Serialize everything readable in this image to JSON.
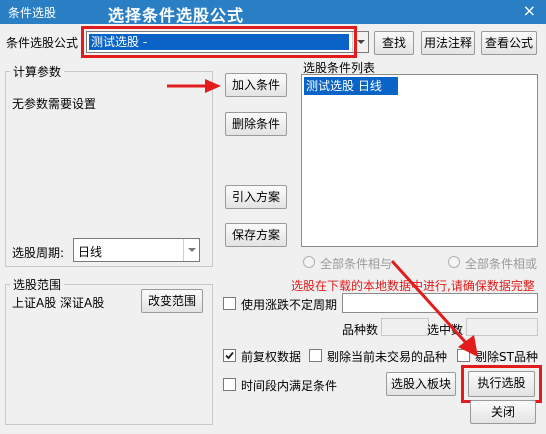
{
  "window": {
    "title": "条件选股",
    "close_glyph": "×"
  },
  "annotation": {
    "title": "选择条件选股公式",
    "color": "#e21c1c"
  },
  "formula": {
    "label": "条件选股公式",
    "selected_value": "测试选股     -",
    "btn_find": "查找",
    "btn_usage": "用法注释",
    "btn_view": "查看公式"
  },
  "params": {
    "group_title": "计算参数",
    "no_params_text": "无参数需要设置",
    "period_label": "选股周期:",
    "period_value": "日线"
  },
  "actions": {
    "add_condition": "加入条件",
    "delete_condition": "删除条件",
    "import_plan": "引入方案",
    "save_plan": "保存方案"
  },
  "condition_list": {
    "label": "选股条件列表",
    "items": [
      "测试选股  日线"
    ]
  },
  "logic": {
    "all_and": "全部条件相与",
    "all_or": "全部条件相或"
  },
  "notice": "选股在下载的本地数据中进行,请确保数据完整",
  "range": {
    "group_title": "选股范围",
    "value": "上证A股 深证A股",
    "change_button": "改变范围"
  },
  "options": {
    "use_irregular_period": "使用涨跌不定周期",
    "variety_count_label": "品种数",
    "selected_count_label": "选中数",
    "pre_adjust": "前复权数据",
    "exclude_not_traded": "剔除当前未交易的品种",
    "exclude_st": "剔除ST品种",
    "time_range": "时间段内满足条件"
  },
  "bottom": {
    "to_block": "选股入板块",
    "execute": "执行选股",
    "close": "关闭"
  }
}
